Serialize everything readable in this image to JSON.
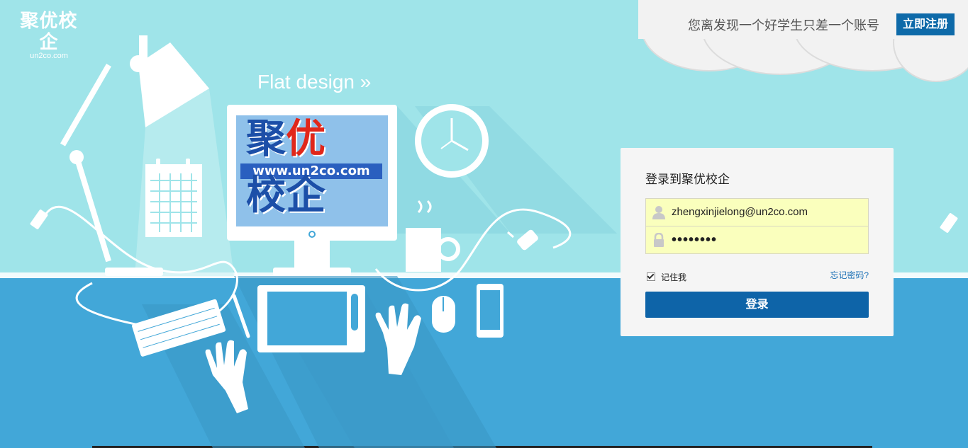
{
  "header": {
    "logo_text": "聚优校企",
    "logo_subtext": "un2co.com",
    "slogan": "您离发现一个好学生只差一个账号",
    "register_label": "立即注册"
  },
  "hero": {
    "tagline": "Flat design",
    "tagline_arrow": "»",
    "monitor_logo": {
      "line1_a": "聚",
      "line1_b": "优",
      "url": "www.un2co.com",
      "line2": "校企"
    }
  },
  "login": {
    "title": "登录到聚优校企",
    "username_value": "zhengxinjielong@un2co.com",
    "password_mask": "••••••••",
    "remember_label": "记住我",
    "remember_checked": true,
    "forgot_label": "忘记密码?",
    "submit_label": "登录"
  },
  "colors": {
    "sky": "#9fe4e9",
    "floor": "#42a7d8",
    "primary": "#0e64a8",
    "autofill": "#faffbd"
  }
}
